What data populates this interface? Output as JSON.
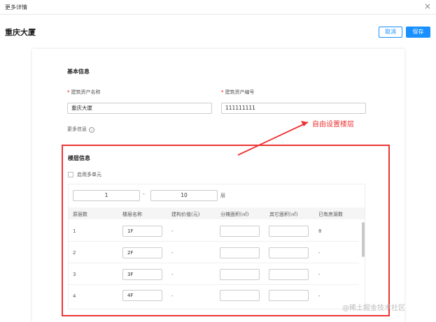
{
  "window": {
    "title": "更多详情",
    "close_icon": "×"
  },
  "header": {
    "building_name": "重庆大厦",
    "cancel_label": "取消",
    "save_label": "保存"
  },
  "basic": {
    "section_title": "基本信息",
    "field1_label": "建筑资产名称",
    "field1_value": "重庆大厦",
    "field2_label": "建筑资产编号",
    "field2_value": "111111111",
    "more_label": "更多信息",
    "more_icon": "⌄"
  },
  "annotation": {
    "text": "自由设置楼层"
  },
  "floor": {
    "section_title": "楼层信息",
    "multi_unit_label": "启用多单元",
    "range_from": "1",
    "range_dash": "-",
    "range_to": "10",
    "range_unit": "层",
    "columns": [
      "原层数",
      "楼层名称",
      "建构价值(元)",
      "分摊面积(㎡)",
      "其它面积(㎡)",
      "已有房源数"
    ],
    "rows": [
      {
        "num": "1",
        "name": "1F",
        "value": "-",
        "houses": "8"
      },
      {
        "num": "2",
        "name": "2F",
        "value": "-",
        "houses": "-"
      },
      {
        "num": "3",
        "name": "3F",
        "value": "-",
        "houses": "-"
      },
      {
        "num": "4",
        "name": "4F",
        "value": "-",
        "houses": "-"
      }
    ]
  },
  "watermark": "@稀土掘金技术社区",
  "colors": {
    "primary": "#1890ff",
    "annotation_red": "#e33333"
  }
}
